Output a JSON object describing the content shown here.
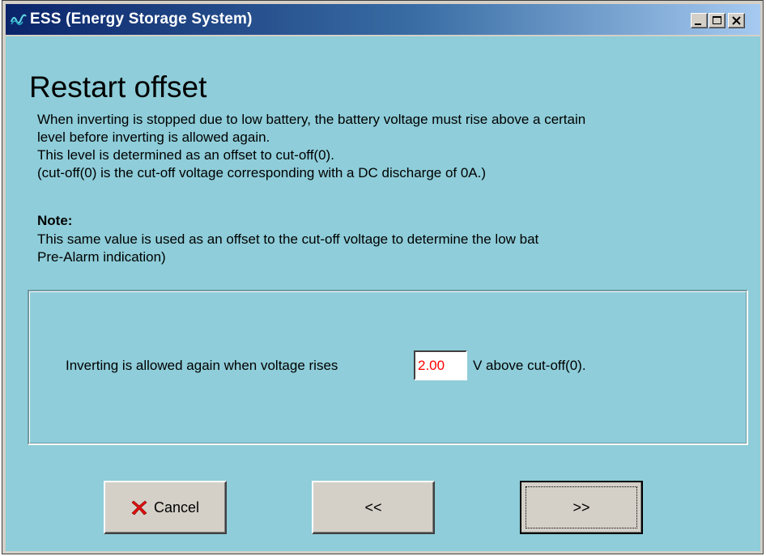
{
  "window": {
    "title": "ESS (Energy Storage System)",
    "controls": {
      "minimize_icon": "minimize-icon",
      "maximize_icon": "maximize-icon",
      "close_icon": "close-icon"
    }
  },
  "page": {
    "heading": "Restart offset",
    "description_lines": [
      "When inverting is stopped due to low battery, the battery voltage must rise above a certain",
      "level before inverting is allowed again.",
      "This level is determined as an offset to cut-off(0).",
      "(cut-off(0) is the cut-off voltage corresponding with a DC discharge of 0A.)"
    ],
    "note_label": "Note:",
    "note_lines": [
      "This same value is used as an offset to the cut-off voltage to determine the low bat",
      "Pre-Alarm indication)"
    ]
  },
  "setting": {
    "prefix": "Inverting is allowed again when voltage rises",
    "value": "2.00",
    "suffix": "V above cut-off(0)."
  },
  "buttons": {
    "cancel_label": "Cancel",
    "back_label": "<<",
    "next_label": ">>"
  },
  "colors": {
    "client_background": "#8ecdd9",
    "value_text": "#ff0000",
    "title_gradient_start": "#0a246a",
    "title_gradient_end": "#a6caf0"
  }
}
